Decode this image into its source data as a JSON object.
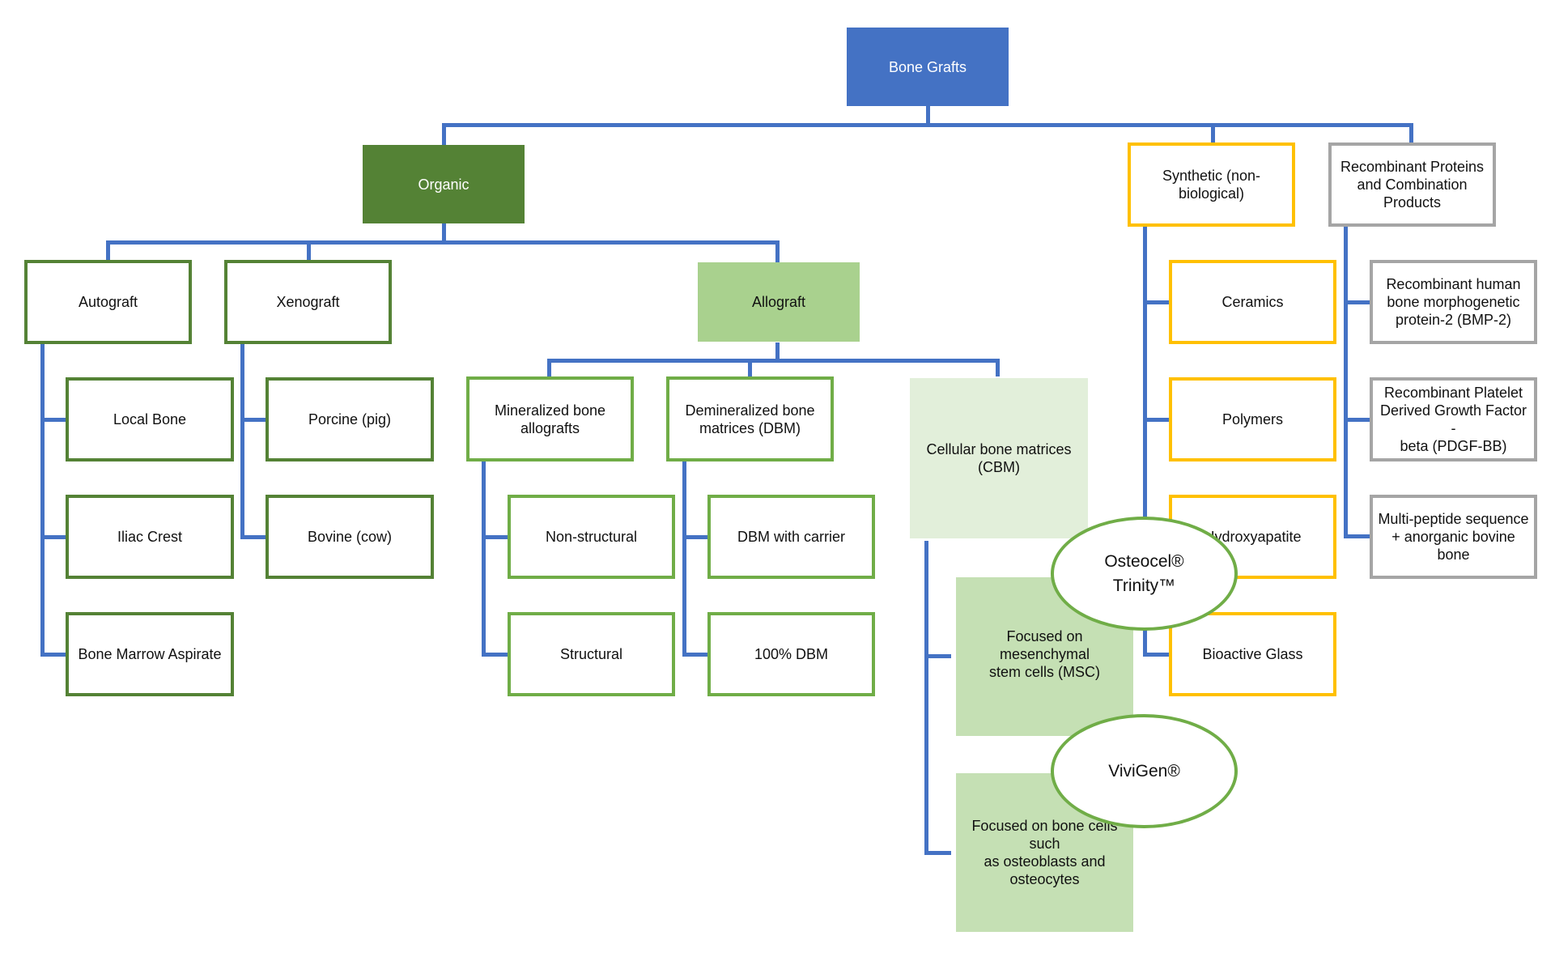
{
  "title": "Bone Grafts",
  "colors": {
    "connector": "#4472c4",
    "root_fill": "#4472c4",
    "organic_fill": "#548235",
    "allograft_fill": "#a9d18e",
    "cbm_fill": "#e2efda",
    "cbm_sub_fill": "#c5e0b4",
    "organic_border": "#548235",
    "allograft_border": "#70ad47",
    "synthetic_border": "#ffc000",
    "recombinant_border": "#a5a5a5",
    "product_ellipse_border": "#70ad47"
  },
  "root": {
    "label": "Bone Grafts"
  },
  "organic": {
    "label": "Organic",
    "autograft": {
      "label": "Autograft",
      "children": [
        "Local Bone",
        "Iliac Crest",
        "Bone Marrow Aspirate"
      ]
    },
    "xenograft": {
      "label": "Xenograft",
      "children": [
        "Porcine (pig)",
        "Bovine (cow)"
      ]
    },
    "allograft": {
      "label": "Allograft",
      "mineralized": {
        "label": "Mineralized bone\nallografts",
        "children": [
          "Non-structural",
          "Structural"
        ]
      },
      "dbm": {
        "label": "Demineralized bone\nmatrices (DBM)",
        "children": [
          "DBM with carrier",
          "100% DBM"
        ]
      },
      "cbm": {
        "label": "Cellular bone matrices\n(CBM)",
        "children": [
          "Focused on mesenchymal\nstem cells (MSC)",
          "Focused on bone cells such\nas osteoblasts and\nosteocytes"
        ]
      }
    }
  },
  "synthetic": {
    "label": "Synthetic (non-\nbiological)",
    "children": [
      "Ceramics",
      "Polymers",
      "Hydroxyapatite",
      "Bioactive Glass"
    ]
  },
  "recombinant": {
    "label": "Recombinant Proteins\nand Combination\nProducts",
    "children": [
      "Recombinant human\nbone morphogenetic\nprotein-2 (BMP-2)",
      "Recombinant Platelet\nDerived Growth Factor -\nbeta (PDGF-BB)",
      "Multi-peptide sequence\n+ anorganic bovine bone"
    ]
  },
  "products": [
    {
      "label": "Osteocel®\nTrinity™"
    },
    {
      "label": "ViviGen®"
    }
  ]
}
